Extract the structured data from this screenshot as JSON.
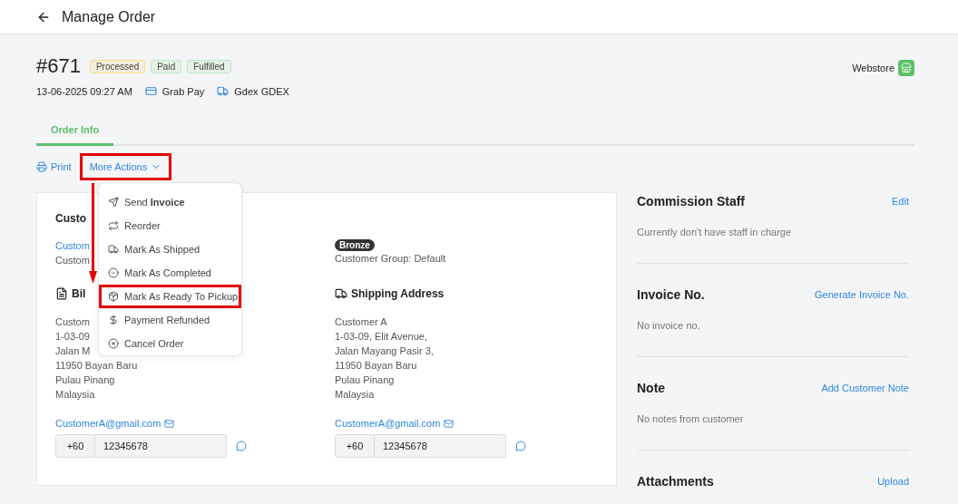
{
  "header": {
    "title": "Manage Order"
  },
  "order": {
    "number": "#671",
    "statuses": [
      {
        "label": "Processed",
        "color": "#f7e08a"
      },
      {
        "label": "Paid",
        "color": "#bfe8c4"
      },
      {
        "label": "Fulfilled",
        "color": "#bfe8c4"
      }
    ],
    "date": "13-06-2025 09:27 AM",
    "payment": "Grab Pay",
    "shipping": "Gdex GDEX",
    "channel": "Webstore"
  },
  "tabs": [
    {
      "label": "Order Info",
      "selected": true
    }
  ],
  "toolbar": {
    "print": "Print",
    "more_actions": {
      "label": "More Actions",
      "highlighted": true
    }
  },
  "menu": [
    {
      "kind": "send",
      "label": "Send **Invoice**",
      "highlighted": false
    },
    {
      "kind": "reorder",
      "label": "Reorder",
      "highlighted": false
    },
    {
      "kind": "shipped",
      "label": "Mark As Shipped",
      "highlighted": false
    },
    {
      "kind": "completed",
      "label": "Mark As Completed",
      "highlighted": false
    },
    {
      "kind": "pickup",
      "label": "Mark As Ready To Pickup",
      "highlighted": true
    },
    {
      "kind": "refund",
      "label": "Payment Refunded",
      "highlighted": false
    },
    {
      "kind": "cancel",
      "label": "Cancel Order",
      "highlighted": false
    }
  ],
  "customer": {
    "heading": "Custo",
    "name_link": "Custom",
    "line": "Custom",
    "tier": "Bronze",
    "group": "Customer Group: Default"
  },
  "addresses": [
    {
      "kind": "billing",
      "heading": "Bil",
      "lines": [
        "Custom",
        "1-03-09",
        "Jalan M",
        "11950 Bayan Baru",
        "Pulau Pinang",
        "Malaysia"
      ],
      "email": "CustomerA@gmail.com",
      "code": "+60",
      "phone": "12345678"
    },
    {
      "kind": "shipping",
      "heading": "Shipping Address",
      "lines": [
        "Customer A",
        "1-03-09, Elit Avenue,",
        "Jalan Mayang Pasir 3,",
        "11950 Bayan Baru",
        "Pulau Pinang",
        "Malaysia"
      ],
      "email": "CustomerA@gmail.com",
      "code": "+60",
      "phone": "12345678"
    }
  ],
  "side": [
    {
      "title": "Commission Staff",
      "action": "Edit",
      "text": "Currently don't have staff in charge"
    },
    {
      "title": "Invoice No.",
      "action": "Generate Invoice No.",
      "text": "No invoice no."
    },
    {
      "title": "Note",
      "action": "Add Customer Note",
      "text": "No notes from customer"
    },
    {
      "title": "Attachments",
      "action": "Upload"
    }
  ]
}
